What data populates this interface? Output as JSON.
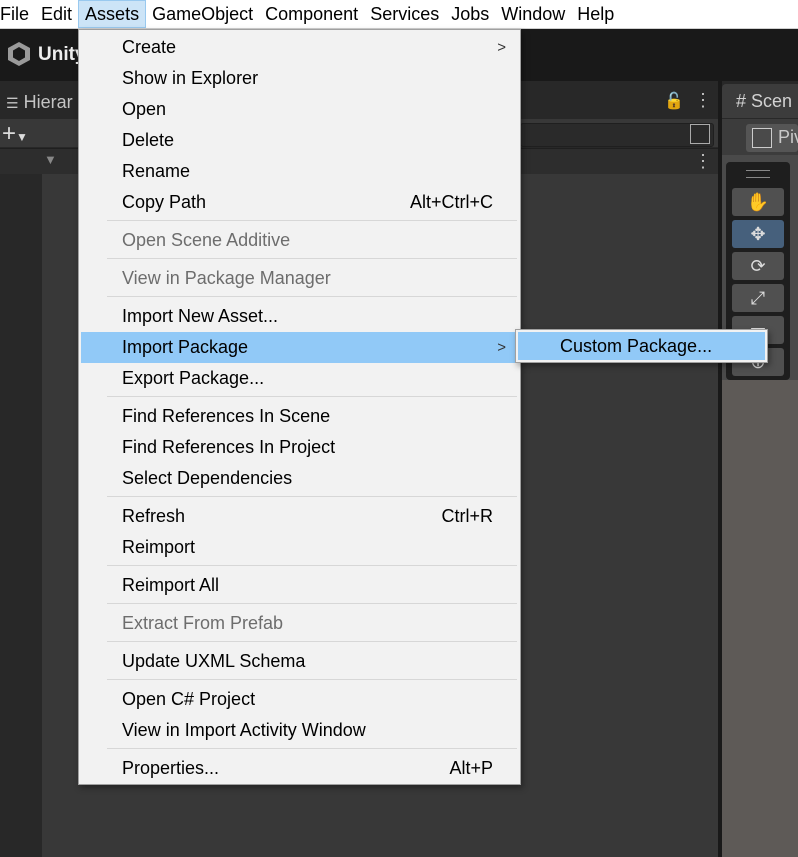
{
  "menubar": {
    "items": [
      "File",
      "Edit",
      "Assets",
      "GameObject",
      "Component",
      "Services",
      "Jobs",
      "Window",
      "Help"
    ],
    "active": "Assets"
  },
  "header": {
    "title": "Unity"
  },
  "hierarchy": {
    "tab_label": "Hierar"
  },
  "scene": {
    "tab_label": "Scen",
    "pivot_label": "Piv"
  },
  "assets_menu": {
    "items": [
      {
        "label": "Create",
        "submenu": true
      },
      {
        "label": "Show in Explorer"
      },
      {
        "label": "Open"
      },
      {
        "label": "Delete"
      },
      {
        "label": "Rename"
      },
      {
        "label": "Copy Path",
        "shortcut": "Alt+Ctrl+C"
      },
      {
        "label": "Open Scene Additive",
        "disabled": true
      },
      {
        "label": "View in Package Manager",
        "disabled": true
      },
      {
        "label": "Import New Asset..."
      },
      {
        "label": "Import Package",
        "submenu": true,
        "highlighted": true
      },
      {
        "label": "Export Package..."
      },
      {
        "label": "Find References In Scene"
      },
      {
        "label": "Find References In Project"
      },
      {
        "label": "Select Dependencies"
      },
      {
        "label": "Refresh",
        "shortcut": "Ctrl+R"
      },
      {
        "label": "Reimport"
      },
      {
        "label": "Reimport All"
      },
      {
        "label": "Extract From Prefab",
        "disabled": true
      },
      {
        "label": "Update UXML Schema"
      },
      {
        "label": "Open C# Project"
      },
      {
        "label": "View in Import Activity Window"
      },
      {
        "label": "Properties...",
        "shortcut": "Alt+P"
      }
    ]
  },
  "import_package_submenu": {
    "items": [
      {
        "label": "Custom Package...",
        "highlighted": true
      }
    ]
  },
  "colors": {
    "highlight": "#91c9f7",
    "menu_bg": "#f2f2f2",
    "disabled_text": "#6d6d6d"
  }
}
